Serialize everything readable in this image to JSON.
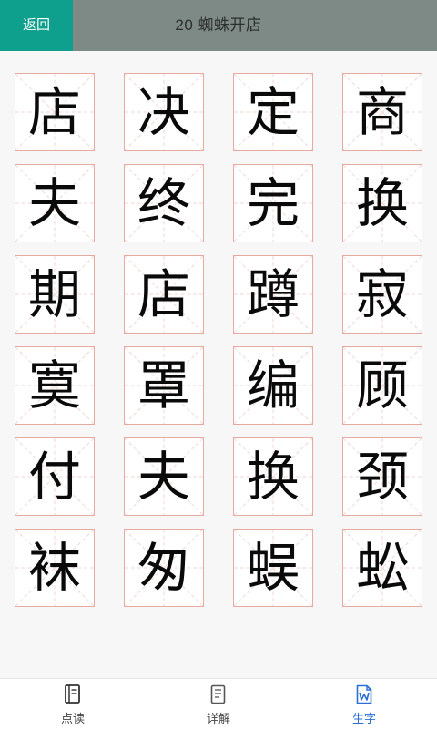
{
  "header": {
    "back_label": "返回",
    "title": "20  蜘蛛开店"
  },
  "characters": [
    "店",
    "决",
    "定",
    "商",
    "夫",
    "终",
    "完",
    "换",
    "期",
    "店",
    "蹲",
    "寂",
    "寞",
    "罩",
    "编",
    "顾",
    "付",
    "夫",
    "换",
    "颈",
    "袜",
    "匆",
    "蜈",
    "蚣"
  ],
  "bottom_nav": {
    "items": [
      {
        "label": "点读",
        "icon": "book-icon",
        "active": false
      },
      {
        "label": "详解",
        "icon": "document-icon",
        "active": false
      },
      {
        "label": "生字",
        "icon": "word-file-icon",
        "active": true
      }
    ]
  },
  "colors": {
    "header_bg": "#7e8a85",
    "back_button_bg": "#0f9f8d",
    "cell_border": "#e8a9a3",
    "active_tab": "#2a6fd6"
  }
}
